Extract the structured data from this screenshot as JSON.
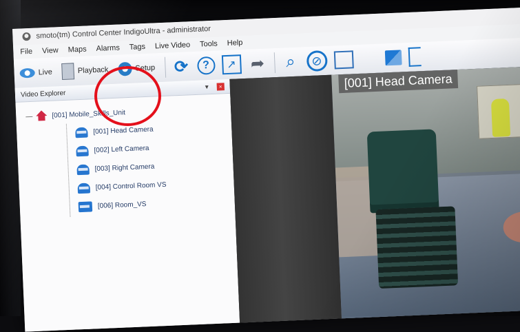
{
  "window": {
    "title": "smoto(tm) Control Center IndigoUltra - administrator"
  },
  "menu": [
    "File",
    "View",
    "Maps",
    "Alarms",
    "Tags",
    "Live Video",
    "Tools",
    "Help"
  ],
  "toolbar": {
    "live_label": "Live",
    "playback_label": "Playback",
    "setup_label": "Setup",
    "tool_icons": [
      "refresh-icon",
      "help-icon",
      "fullscreen-icon",
      "share-icon",
      "search-icon",
      "ban-icon",
      "export-icon",
      "grid-icon",
      "window-icon",
      "bracket-icon"
    ]
  },
  "explorer": {
    "title": "Video Explorer",
    "root_label": "[001] Mobile_Skills_Unit",
    "cameras": [
      "[001] Head Camera",
      "[002] Left Camera",
      "[003] Right Camera",
      "[004] Control Room VS",
      "[006] Room_VS"
    ]
  },
  "video": {
    "label": "[001] Head Camera"
  },
  "colors": {
    "accent": "#1673c9",
    "annotation": "#e4101b",
    "site": "#ce1d3b"
  }
}
